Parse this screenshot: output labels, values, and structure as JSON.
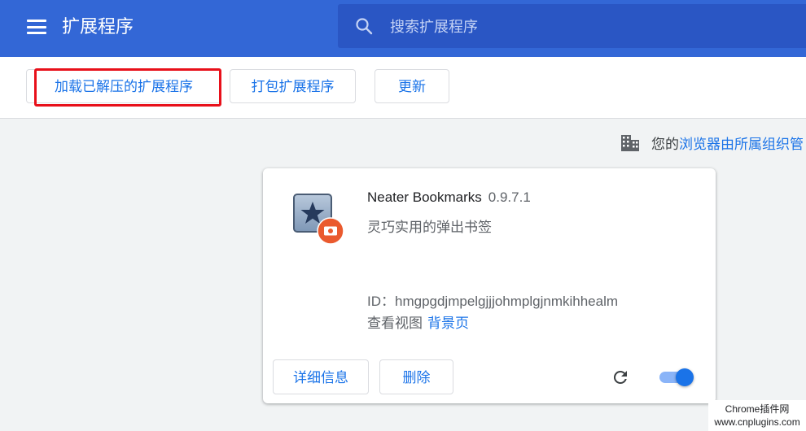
{
  "header": {
    "title": "扩展程序",
    "search": {
      "placeholder": "搜索扩展程序",
      "value": ""
    }
  },
  "toolbar": {
    "load_unpacked_label": "加载已解压的扩展程序",
    "pack_label": "打包扩展程序",
    "update_label": "更新"
  },
  "managed_notice": {
    "prefix": "您的",
    "link": "浏览器由所属组织管"
  },
  "extension": {
    "name": "Neater Bookmarks",
    "version": "0.9.7.1",
    "description": "灵巧实用的弹出书签",
    "id_label": "ID：",
    "id": "hmgpgdjmpelgjjjohmplgjnmkihhealm",
    "views_label": "查看视图",
    "views_link": "背景页",
    "details_label": "详细信息",
    "remove_label": "删除",
    "enabled": true
  },
  "icons": {
    "menu": "hamburger-menu-icon",
    "search": "search-icon",
    "building": "building-icon",
    "extension": "star-bookmark-icon",
    "badge": "unpacked-badge-icon",
    "reload": "reload-icon"
  },
  "colors": {
    "header_bg": "#3367d6",
    "accent": "#1a73e8",
    "highlight": "#e8101a",
    "badge": "#ea5a2e"
  },
  "watermark": {
    "line1": "Chrome插件网",
    "line2": "www.cnplugins.com"
  }
}
